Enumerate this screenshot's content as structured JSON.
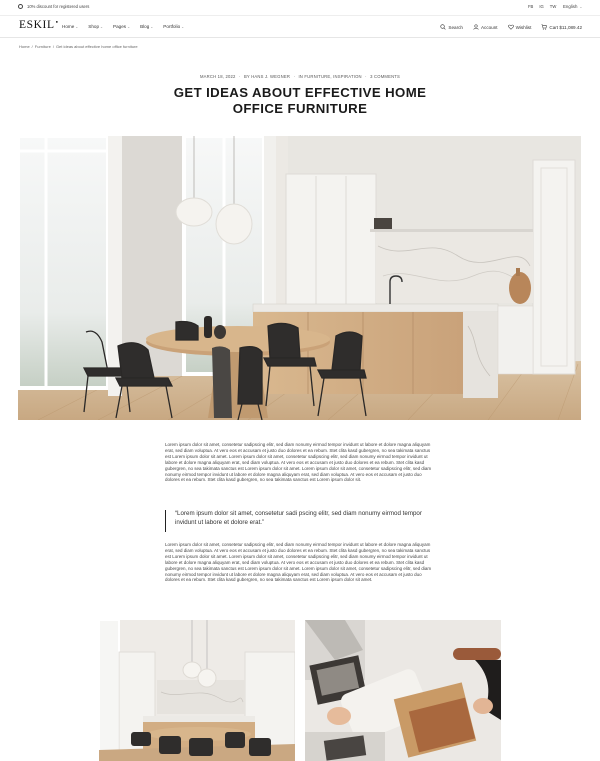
{
  "topbar": {
    "promo_text": "10% discount for registered users",
    "social": [
      "FB",
      "IG",
      "TW"
    ],
    "language": "English"
  },
  "nav": {
    "logo": "ESKIL",
    "menu": [
      "Home",
      "Shop",
      "Pages",
      "Blog",
      "Portfolio"
    ],
    "search_label": "Search",
    "account_label": "Account",
    "wishlist_label": "Wishlist",
    "cart_label": "Cart $11,089.42"
  },
  "breadcrumb": {
    "home": "Home",
    "sep": "/",
    "category": "Furniture",
    "current": "Get ideas about effective home office furniture"
  },
  "article": {
    "date": "MARCH 18, 2022",
    "author": "BY HANS J. WEGNER",
    "categories": "IN FURNITURE, INSPIRATION",
    "comments": "3 COMMENTS",
    "dot": "·",
    "title": "GET IDEAS ABOUT EFFECTIVE HOME OFFICE FURNITURE",
    "paragraph1": "Lorem ipsum dolor sit amet, consetetur sadipscing elitr, sed diam nonumy eirmod tempor invidunt ut labore et dolore magna aliquyam erat, sed diam voluptua. At vero eos et accusam et justo duo dolores et ea rebum. Stet clita kasd gubergren, no sea takimata sanctus est Lorem ipsum dolor sit amet. Lorem ipsum dolor sit amet, consetetur sadipscing elitr, sed diam nonumy eirmod tempor invidunt ut labore et dolore magna aliquyam erat, sed diam voluptua. At vero eos et accusam et justo duo dolores et ea rebum. Stet clita kasd gubergren, no sea takimata sanctus est Lorem ipsum dolor sit amet. Lorem ipsum dolor sit amet, consetetur sadipscing elitr, sed diam nonumy eirmod tempor invidunt ut labore et dolore magna aliquyam erat, sed diam voluptua. At vero eos et accusam et justo duo dolores et ea rebum. Stet clita kasd gubergren, no sea takimata sanctus est Lorem ipsum dolor sit.",
    "quote": "“Lorem ipsum dolor sit amet, consetetur sadi pscing elitr, sed diam nonumy eirmod tempor invidunt ut labore et dolore erat.”",
    "paragraph2": "Lorem ipsum dolor sit amet, consetetur sadipscing elitr, sed diam nonumy eirmod tempor invidunt ut labore et dolore magna aliquyam erat, sed diam voluptua. At vero eos et accusam et justo duo dolores et ea rebum. Stet clita kasd gubergren, no sea takimata sanctus est Lorem ipsum dolor sit amet. Lorem ipsum dolor sit amet, consetetur sadipscing elitr, sed diam nonumy eirmod tempor invidunt ut labore et dolore magna aliquyam erat, sed diam voluptua. At vero eos et accusam et justo duo dolores et ea rebum. Stet clita kasd gubergren, no sea takimata sanctus est Lorem ipsum dolor sit amet. Lorem ipsum dolor sit amet, consetetur sadipscing elitr, sed diam nonumy eirmod tempor invidunt ut labore et dolore magna aliquyam erat, sed diam voluptua. At vero eos et accusam et justo duo dolores et ea rebum. Stet clita kasd gubergren, no sea takimata sanctus est Lorem ipsum dolor sit amet."
  },
  "icons": {
    "promo": "discount-icon",
    "search": "search-icon",
    "account": "user-icon",
    "wishlist": "heart-icon",
    "cart": "cart-icon"
  },
  "colors": {
    "text": "#222222",
    "muted": "#666666",
    "wood": "#c9a37a",
    "marble": "#e9e7e3"
  }
}
